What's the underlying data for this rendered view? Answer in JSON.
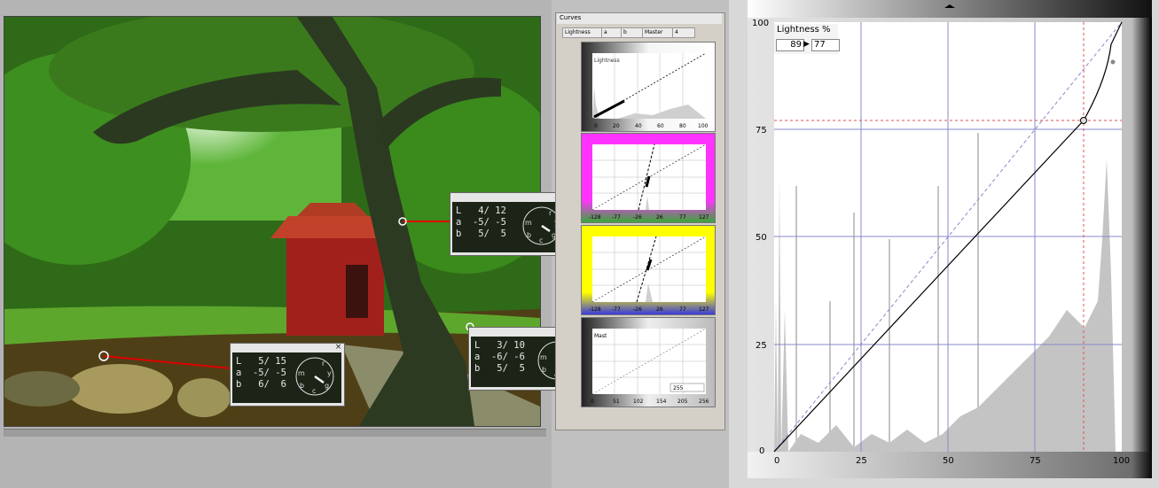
{
  "curves_panel": {
    "title": "Curves",
    "tabs": [
      "Lightness",
      "a",
      "b",
      "Master",
      "4"
    ],
    "lightness_label": "Lightness",
    "lightness_ticks": [
      "0",
      "20",
      "40",
      "60",
      "80",
      "100"
    ],
    "a_ticks": [
      "-128",
      "-77",
      "-26",
      "26",
      "77",
      "127"
    ],
    "b_ticks": [
      "-128",
      "-77",
      "-26",
      "26",
      "77",
      "127"
    ],
    "master_label": "Mast",
    "master_ticks": [
      "0",
      "51",
      "102",
      "154",
      "205",
      "256"
    ],
    "master_field": "255"
  },
  "big_curve": {
    "label": "Lightness %",
    "input_value": "89",
    "output_value": "77",
    "y_ticks": [
      "100",
      "75",
      "50",
      "25",
      "0"
    ],
    "x_ticks": [
      "0",
      "25",
      "50",
      "75",
      "100"
    ]
  },
  "readouts": [
    {
      "L": "4/ 12",
      "a": "-5/ -5",
      "b": "5/  5"
    },
    {
      "L": "3/ 10",
      "a": "-6/ -6",
      "b": "5/  5"
    },
    {
      "L": "5/ 15",
      "a": "-5/ -5",
      "b": "6/  6"
    }
  ],
  "readout_labels": {
    "L": "L",
    "a": "a",
    "b": "b"
  },
  "clock_letters": [
    "r",
    "y",
    "g",
    "c",
    "b",
    "m"
  ],
  "colors": {
    "red_line": "#e00000",
    "magenta": "#ff33ff",
    "yellow": "#ffff00"
  }
}
